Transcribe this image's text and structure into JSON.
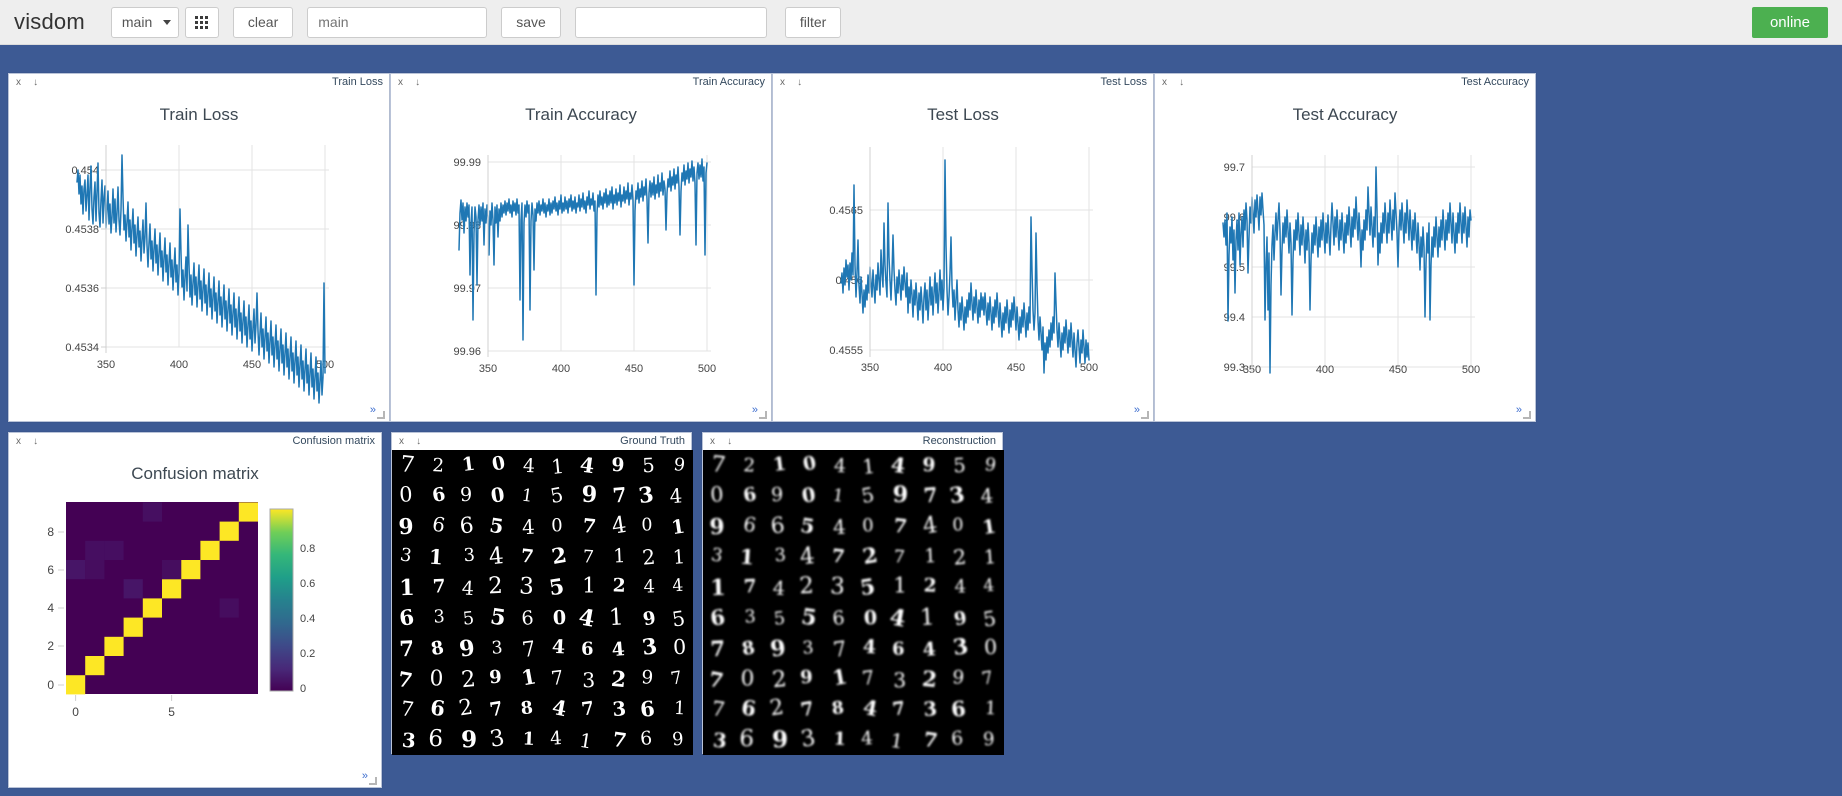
{
  "app": {
    "brand": "visdom",
    "background_color": "#3d5a94"
  },
  "toolbar": {
    "env_select_value": "main",
    "grid_button_icon": "grid-icon",
    "clear_label": "clear",
    "env_name_value": "main",
    "env_name_placeholder": "main",
    "save_label": "save",
    "filter_value": "",
    "filter_placeholder": "",
    "filter_label": "filter",
    "status": "online",
    "status_color": "#4cb050"
  },
  "panes": [
    {
      "id": "train-loss",
      "header_title": "Train Loss",
      "close_icon": "x",
      "download_icon": "↓",
      "expand_icon": "»"
    },
    {
      "id": "train-accuracy",
      "header_title": "Train Accuracy",
      "close_icon": "x",
      "download_icon": "↓",
      "expand_icon": "»"
    },
    {
      "id": "test-loss",
      "header_title": "Test Loss",
      "close_icon": "x",
      "download_icon": "↓",
      "expand_icon": "»"
    },
    {
      "id": "test-accuracy",
      "header_title": "Test Accuracy",
      "close_icon": "x",
      "download_icon": "↓",
      "expand_icon": "»"
    },
    {
      "id": "confusion-matrix",
      "header_title": "Confusion matrix",
      "close_icon": "x",
      "download_icon": "↓",
      "expand_icon": "»"
    },
    {
      "id": "ground-truth",
      "header_title": "Ground Truth",
      "close_icon": "x",
      "download_icon": "↓"
    },
    {
      "id": "reconstruction",
      "header_title": "Reconstruction",
      "close_icon": "x",
      "download_icon": "↓"
    }
  ],
  "chart_data": [
    {
      "type": "line",
      "id": "train-loss",
      "title": "Train Loss",
      "xlabel": "",
      "ylabel": "",
      "xlim": [
        330,
        501
      ],
      "ylim": [
        0.45332,
        0.45412
      ],
      "xticks": [
        350,
        400,
        450,
        500
      ],
      "yticks": [
        0.4534,
        0.4536,
        0.4538,
        0.454
      ],
      "grid": true,
      "legend": "none",
      "line_color": "#1f77b4",
      "x": [
        330,
        331,
        332,
        333,
        334,
        335,
        336,
        337,
        338,
        339,
        340,
        341,
        342,
        343,
        344,
        345,
        346,
        347,
        348,
        349,
        350,
        351,
        352,
        353,
        354,
        355,
        356,
        357,
        358,
        359,
        360,
        361,
        362,
        363,
        364,
        365,
        366,
        367,
        368,
        369,
        370,
        371,
        372,
        373,
        374,
        375,
        376,
        377,
        378,
        379,
        380,
        381,
        382,
        383,
        384,
        385,
        386,
        387,
        388,
        389,
        390,
        391,
        392,
        393,
        394,
        395,
        396,
        397,
        398,
        399,
        400,
        401,
        402,
        403,
        404,
        405,
        406,
        407,
        408,
        409,
        410,
        411,
        412,
        413,
        414,
        415,
        416,
        417,
        418,
        419,
        420,
        421,
        422,
        423,
        424,
        425,
        426,
        427,
        428,
        429,
        430,
        431,
        432,
        433,
        434,
        435,
        436,
        437,
        438,
        439,
        440,
        441,
        442,
        443,
        444,
        445,
        446,
        447,
        448,
        449,
        450,
        451,
        452,
        453,
        454,
        455,
        456,
        457,
        458,
        459,
        460,
        461,
        462,
        463,
        464,
        465,
        466,
        467,
        468,
        469,
        470,
        471,
        472,
        473,
        474,
        475,
        476,
        477,
        478,
        479,
        480,
        481,
        482,
        483,
        484,
        485,
        486,
        487,
        488,
        489,
        490,
        491,
        492,
        493,
        494,
        495,
        496,
        497,
        498,
        499,
        500
      ],
      "y": [
        0.45385,
        0.45398,
        0.45392,
        0.45378,
        0.45382,
        0.45373,
        0.4539,
        0.4538,
        0.45376,
        0.45384,
        0.45379,
        0.45388,
        0.45381,
        0.45374,
        0.45386,
        0.45378,
        0.45393,
        0.45383,
        0.45374,
        0.4538,
        0.45376,
        0.45402,
        0.45386,
        0.45377,
        0.45372,
        0.45381,
        0.45376,
        0.45391,
        0.45383,
        0.45374,
        0.45371,
        0.4538,
        0.45374,
        0.45386,
        0.45378,
        0.4537,
        0.45375,
        0.45384,
        0.45376,
        0.4538,
        0.45372,
        0.45383,
        0.45375,
        0.45369,
        0.45378,
        0.45373,
        0.45408,
        0.45386,
        0.45375,
        0.4537,
        0.45379,
        0.45372,
        0.45368,
        0.45376,
        0.4537,
        0.45365,
        0.45374,
        0.45369,
        0.4538,
        0.45372,
        0.45366,
        0.45362,
        0.45371,
        0.45366,
        0.45375,
        0.45368,
        0.45363,
        0.45358,
        0.45368,
        0.45362,
        0.45358,
        0.4537,
        0.45363,
        0.45357,
        0.45366,
        0.45359,
        0.45354,
        0.45363,
        0.45357,
        0.45368,
        0.4536,
        0.45355,
        0.4535,
        0.4536,
        0.45354,
        0.45349,
        0.45358,
        0.45352,
        0.45346,
        0.45356,
        0.4535,
        0.45345,
        0.45354,
        0.45348,
        0.45343,
        0.45352,
        0.45346,
        0.45341,
        0.4535,
        0.45344,
        0.45352,
        0.45345,
        0.4534,
        0.45348,
        0.45343,
        0.45338,
        0.45346,
        0.45341,
        0.45336,
        0.45344,
        0.45339,
        0.45347,
        0.45341,
        0.45335,
        0.45343,
        0.45338,
        0.45333,
        0.45341,
        0.45336,
        0.45344,
        0.45338,
        0.45333,
        0.45341,
        0.45336,
        0.45331,
        0.45339,
        0.45334,
        0.45342,
        0.45336,
        0.4533,
        0.45338,
        0.45333,
        0.45358,
        0.45344,
        0.45336,
        0.45331,
        0.45339,
        0.45333,
        0.45328,
        0.45336,
        0.4533,
        0.45338,
        0.45332,
        0.45327,
        0.45335,
        0.45329,
        0.45324,
        0.45332,
        0.45327,
        0.45335,
        0.45329,
        0.45324,
        0.45332,
        0.45326,
        0.45321,
        0.45329,
        0.45324,
        0.45332,
        0.45326,
        0.45321,
        0.45329,
        0.45323,
        0.45318,
        0.45326,
        0.45321,
        0.45329,
        0.45323,
        0.45363,
        0.4533
      ]
    },
    {
      "type": "line",
      "id": "train-accuracy",
      "title": "Train Accuracy",
      "xlabel": "",
      "ylabel": "",
      "xlim": [
        330,
        501
      ],
      "ylim": [
        99.9555,
        99.9905
      ],
      "xticks": [
        350,
        400,
        450,
        500
      ],
      "yticks": [
        99.96,
        99.97,
        99.98,
        99.99
      ],
      "grid": true,
      "legend": "none",
      "line_color": "#1f77b4",
      "note": "near-ceiling training accuracy oscillating mostly between 99.978 and 99.986 with sharp downward spikes to ~99.9585 near epoch 388"
    },
    {
      "type": "line",
      "id": "test-loss",
      "title": "Test Loss",
      "xlabel": "",
      "ylabel": "",
      "xlim": [
        330,
        501
      ],
      "ylim": [
        0.45543,
        0.45672
      ],
      "xticks": [
        350,
        400,
        450,
        500
      ],
      "yticks": [
        0.4555,
        0.456,
        0.4565
      ],
      "grid": true,
      "legend": "none",
      "line_color": "#1f77b4",
      "note": "noisy slowly-decreasing test loss around 0.4560 with sharp upward spikes near epochs 338, 368 and 405 (peak ~0.45685)"
    },
    {
      "type": "line",
      "id": "test-accuracy",
      "title": "Test Accuracy",
      "xlabel": "",
      "ylabel": "",
      "xlim": [
        330,
        501
      ],
      "ylim": [
        99.285,
        99.715
      ],
      "xticks": [
        350,
        400,
        450,
        500
      ],
      "yticks": [
        99.3,
        99.4,
        99.5,
        99.6,
        99.7
      ],
      "grid": true,
      "legend": "none",
      "line_color": "#1f77b4",
      "note": "test accuracy fluctuating around 99.55-99.60 with a peak of 99.70 near epoch 443 and a deep dip to 99.32 near epoch 368"
    },
    {
      "type": "heatmap",
      "id": "confusion-matrix",
      "title": "Confusion matrix",
      "xlabel": "",
      "ylabel": "",
      "xticks": [
        0,
        5
      ],
      "yticks": [
        0,
        2,
        4,
        6,
        8
      ],
      "colorbar_ticks": [
        "0",
        "0.2",
        "0.4",
        "0.6",
        "0.8"
      ],
      "colorscale": "viridis",
      "zmin": 0,
      "zmax": 1,
      "rows": 10,
      "cols": 10,
      "values": [
        [
          0.995,
          0.0,
          0.001,
          0.0,
          0.0,
          0.001,
          0.002,
          0.0,
          0.001,
          0.0
        ],
        [
          0.0,
          0.997,
          0.001,
          0.0,
          0.0,
          0.0,
          0.001,
          0.0,
          0.001,
          0.0
        ],
        [
          0.001,
          0.001,
          0.994,
          0.001,
          0.001,
          0.0,
          0.0,
          0.001,
          0.001,
          0.0
        ],
        [
          0.0,
          0.0,
          0.002,
          0.993,
          0.0,
          0.002,
          0.0,
          0.001,
          0.001,
          0.001
        ],
        [
          0.0,
          0.0,
          0.001,
          0.0,
          0.994,
          0.0,
          0.001,
          0.001,
          0.0,
          0.003
        ],
        [
          0.001,
          0.0,
          0.0,
          0.004,
          0.0,
          0.991,
          0.002,
          0.0,
          0.001,
          0.001
        ],
        [
          0.003,
          0.002,
          0.0,
          0.0,
          0.002,
          0.003,
          0.99,
          0.0,
          0.0,
          0.0
        ],
        [
          0.0,
          0.002,
          0.003,
          0.001,
          0.001,
          0.0,
          0.0,
          0.991,
          0.001,
          0.001
        ],
        [
          0.001,
          0.0,
          0.001,
          0.001,
          0.0,
          0.001,
          0.001,
          0.001,
          0.993,
          0.001
        ],
        [
          0.001,
          0.0,
          0.0,
          0.001,
          0.003,
          0.001,
          0.0,
          0.002,
          0.001,
          0.991
        ]
      ]
    }
  ],
  "image_grids": {
    "ground_truth": {
      "title": "Ground Truth",
      "rows": 10,
      "cols": 10,
      "blur": 0,
      "digits": [
        [
          7,
          2,
          1,
          0,
          4,
          1,
          4,
          9,
          5,
          9
        ],
        [
          0,
          6,
          9,
          0,
          1,
          5,
          9,
          7,
          3,
          4
        ],
        [
          9,
          6,
          6,
          5,
          4,
          0,
          7,
          4,
          0,
          1
        ],
        [
          3,
          1,
          3,
          4,
          7,
          2,
          7,
          1,
          2,
          1
        ],
        [
          1,
          7,
          4,
          2,
          3,
          5,
          1,
          2,
          4,
          4
        ],
        [
          6,
          3,
          5,
          5,
          6,
          0,
          4,
          1,
          9,
          5
        ],
        [
          7,
          8,
          9,
          3,
          7,
          4,
          6,
          4,
          3,
          0
        ],
        [
          7,
          0,
          2,
          9,
          1,
          7,
          3,
          2,
          9,
          7
        ],
        [
          7,
          6,
          2,
          7,
          8,
          4,
          7,
          3,
          6,
          1
        ],
        [
          3,
          6,
          9,
          3,
          1,
          4,
          1,
          7,
          6,
          9
        ]
      ]
    },
    "reconstruction": {
      "title": "Reconstruction",
      "rows": 10,
      "cols": 10,
      "blur": 1.1,
      "digits": [
        [
          7,
          2,
          1,
          0,
          4,
          1,
          4,
          9,
          5,
          9
        ],
        [
          0,
          6,
          9,
          0,
          1,
          5,
          9,
          7,
          3,
          4
        ],
        [
          9,
          6,
          6,
          5,
          4,
          0,
          7,
          4,
          0,
          1
        ],
        [
          3,
          1,
          3,
          4,
          7,
          2,
          7,
          1,
          2,
          1
        ],
        [
          1,
          7,
          4,
          2,
          3,
          5,
          1,
          2,
          4,
          4
        ],
        [
          6,
          3,
          5,
          5,
          6,
          0,
          4,
          1,
          9,
          5
        ],
        [
          7,
          8,
          9,
          3,
          7,
          4,
          6,
          4,
          3,
          0
        ],
        [
          7,
          0,
          2,
          9,
          1,
          7,
          3,
          2,
          9,
          7
        ],
        [
          7,
          6,
          2,
          7,
          8,
          4,
          7,
          3,
          6,
          1
        ],
        [
          3,
          6,
          9,
          3,
          1,
          4,
          1,
          7,
          6,
          9
        ]
      ]
    }
  }
}
